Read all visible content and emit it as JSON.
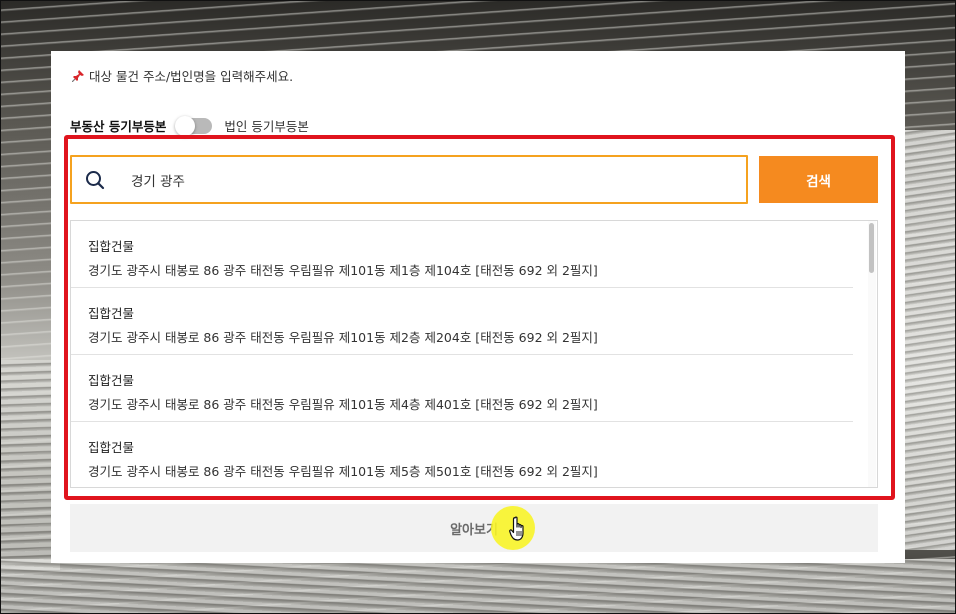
{
  "notice": {
    "icon": "pushpin-icon",
    "text": "대상 물건 주소/법인명을 입력해주세요."
  },
  "toggle": {
    "left_label": "부동산 등기부등본",
    "right_label": "법인 등기부등본",
    "state": "off"
  },
  "search": {
    "value": "경기 광주",
    "icon": "search-icon",
    "button_label": "검색"
  },
  "results": [
    {
      "type": "집합건물",
      "address": "경기도 광주시 태봉로 86 광주 태전동 우림필유 제101동 제1층 제104호 [태전동 692 외 2필지]"
    },
    {
      "type": "집합건물",
      "address": "경기도 광주시 태봉로 86 광주 태전동 우림필유 제101동 제2층 제204호 [태전동 692 외 2필지]"
    },
    {
      "type": "집합건물",
      "address": "경기도 광주시 태봉로 86 광주 태전동 우림필유 제101동 제4층 제401호 [태전동 692 외 2필지]"
    },
    {
      "type": "집합건물",
      "address": "경기도 광주시 태봉로 86 광주 태전동 우림필유 제101동 제5층 제501호 [태전동 692 외 2필지]"
    }
  ],
  "learn_more": {
    "label": "알아보기"
  },
  "colors": {
    "accent_orange": "#f58a1f",
    "search_border": "#f5a21f",
    "highlight_red": "#e0141d",
    "cursor_yellow": "#f8f428"
  }
}
